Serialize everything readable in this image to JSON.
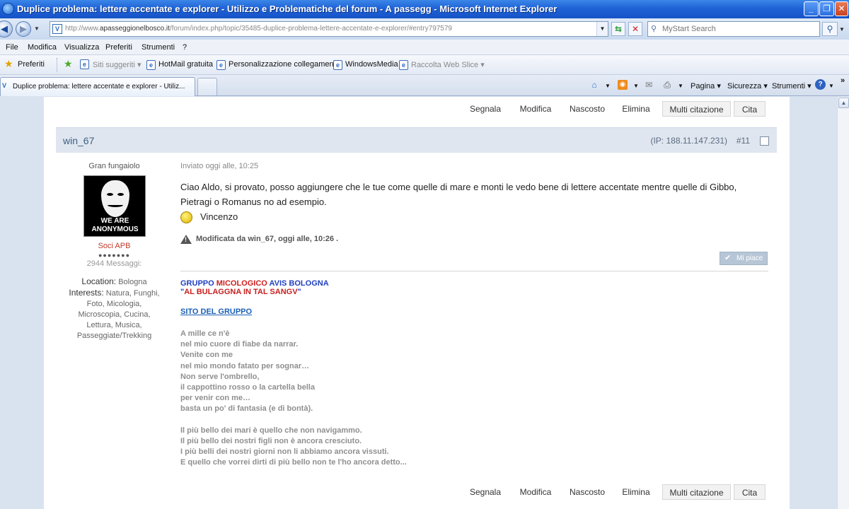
{
  "window": {
    "title": "Duplice problema: lettere accentate e explorer - Utilizzo e Problematiche del forum - A passegg - Microsoft Internet Explorer"
  },
  "address": {
    "url_prefix": "http://www.",
    "url_domain": "apasseggionelbosco.it",
    "url_path": "/forum/index.php/topic/35485-duplice-problema-lettere-accentate-e-explorer/#entry797579",
    "search_placeholder": "MyStart Search"
  },
  "menu": [
    "File",
    "Modifica",
    "Visualizza",
    "Preferiti",
    "Strumenti",
    "?"
  ],
  "favorites": {
    "label": "Preferiti",
    "items": [
      "Siti suggeriti",
      "HotMail gratuita",
      "Personalizzazione collegamenti",
      "WindowsMedia",
      "Raccolta Web Slice"
    ]
  },
  "tab": {
    "title": "Duplice problema: lettere accentate e explorer - Utiliz..."
  },
  "commandbar": {
    "pagina": "Pagina",
    "sicurezza": "Sicurezza",
    "strumenti": "Strumenti"
  },
  "post_actions": [
    "Segnala",
    "Modifica",
    "Nascosto",
    "Elimina",
    "Multi citazione",
    "Cita"
  ],
  "post": {
    "author": "win_67",
    "ip": "(IP: 188.11.147.231)",
    "number": "#11",
    "rank": "Gran fungaiolo",
    "avatar_text": [
      "WE ARE",
      "ANONYMOUS"
    ],
    "group": "Soci APB",
    "pips": "●●●●●●●",
    "messages": "2944 Messaggi:",
    "location_label": "Location:",
    "location": "Bologna",
    "interests_label": "Interests:",
    "interests": [
      "Natura, Funghi,",
      "Foto, Micologia,",
      "Microscopia, Cucina,",
      "Lettura, Musica,",
      "Passeggiate/Trekking"
    ],
    "posted": "Inviato oggi alle, 10:25",
    "text_line1": "Ciao Aldo, si provato, posso aggiungere che le tue come quelle di mare e monti le vedo bene di lettere accentate mentre quelle di Gibbo,",
    "text_line2": "Pietragi o Romanus no ad esempio.",
    "signoff": "Vincenzo",
    "edited": "Modificata da win_67, oggi alle, 10:26 .",
    "like": "Mi piace"
  },
  "signature": {
    "line1_a": "GRUPPO ",
    "line1_b": "MICOLOGICO ",
    "line1_c": "AVIS BOLOGNA",
    "line2_a": "\"",
    "line2_b": "AL BULAGGNA IN TAL SANGV",
    "line2_c": "\"",
    "link": "SITO DEL GRUPPO",
    "poem1": [
      "A mille ce n'è",
      "nel mio cuore di fiabe da narrar.",
      "Venite con me",
      "nel mio mondo fatato per sognar…",
      "Non serve l'ombrello,",
      "il cappottino rosso o la cartella bella",
      "per venir con me…",
      "basta un po' di fantasia (e di bontà)."
    ],
    "poem2": [
      "Il più bello dei mari è quello che non navigammo.",
      "Il più bello dei nostri figli non è ancora cresciuto.",
      "I più belli dei nostri giorni non li abbiamo ancora vissuti.",
      "E quello che vorrei dirti di più bello non te l'ho ancora detto..."
    ]
  }
}
